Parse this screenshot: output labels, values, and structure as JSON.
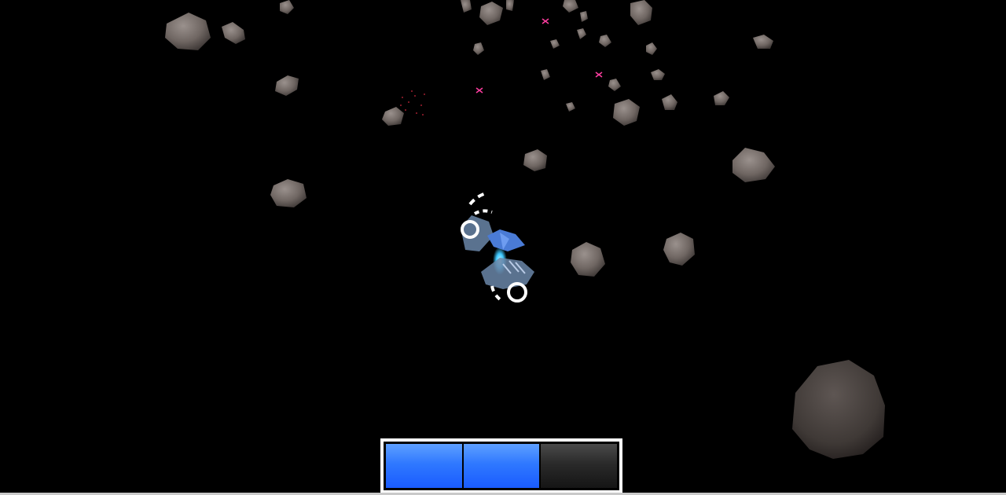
{
  "game": {
    "background_color": "#000000",
    "asteroid_color": "#7a706c",
    "ship_color": "#4a7bd6",
    "thruster_color": "#3ec8ff",
    "debris_color": "#ff3ea0"
  },
  "hud": {
    "energy": {
      "segments_total": 3,
      "segments_filled": 2,
      "filled_color": "#1a5cff",
      "empty_color": "#2a2a2a"
    }
  },
  "scene_objects": {
    "player": {
      "icon": "spaceship-icon"
    },
    "escorts": [
      {
        "icon": "drone-icon"
      },
      {
        "icon": "drone-icon"
      }
    ]
  }
}
